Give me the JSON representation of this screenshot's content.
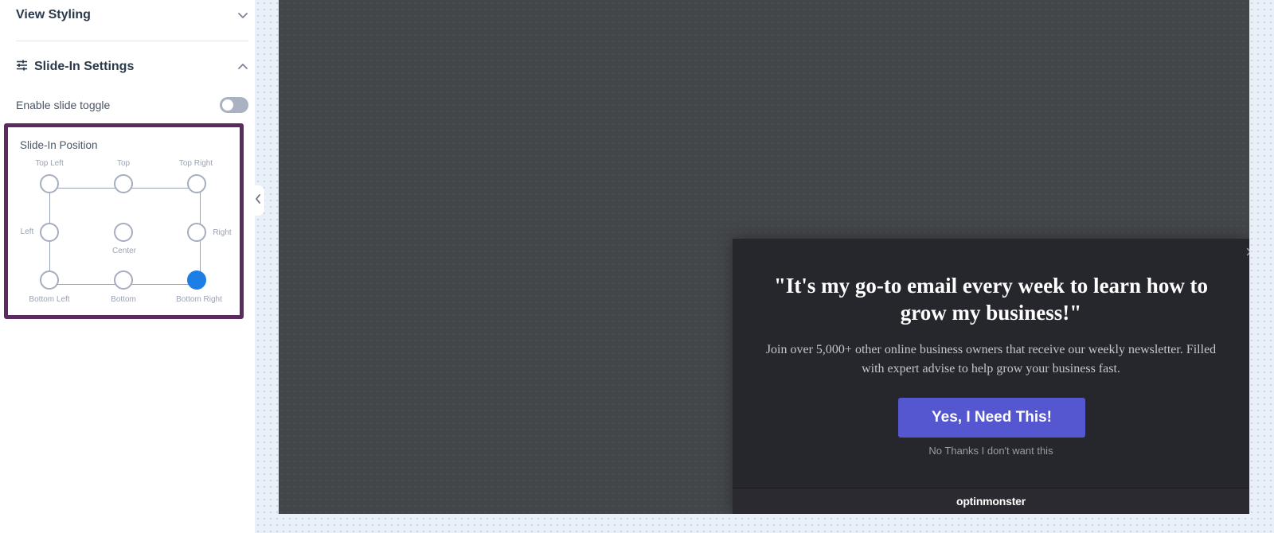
{
  "sidebar": {
    "view_styling": {
      "title": "View Styling"
    },
    "slide_in_settings": {
      "title": "Slide-In Settings"
    },
    "toggle": {
      "label": "Enable slide toggle",
      "enabled": false
    },
    "position": {
      "title": "Slide-In Position",
      "selected": "Bottom Right",
      "labels": {
        "top_left": "Top Left",
        "top": "Top",
        "top_right": "Top Right",
        "left": "Left",
        "center": "Center",
        "right": "Right",
        "bottom_left": "Bottom Left",
        "bottom": "Bottom",
        "bottom_right": "Bottom Right"
      }
    }
  },
  "popup": {
    "headline": "\"It's my go-to email every week to learn how to grow my business!\"",
    "body": "Join over 5,000+ other online business owners that receive our weekly newsletter. Filled with expert advise to help grow your business fast.",
    "cta": "Yes, I Need This!",
    "decline": "No Thanks I don't want this",
    "close": "×",
    "brand": "optinmonster"
  },
  "colors": {
    "accent_frame": "#5c2a5e",
    "selected_position": "#1d7fe6",
    "cta_button": "#5457d0",
    "popup_background": "#26262d",
    "preview_background": "#434649"
  }
}
